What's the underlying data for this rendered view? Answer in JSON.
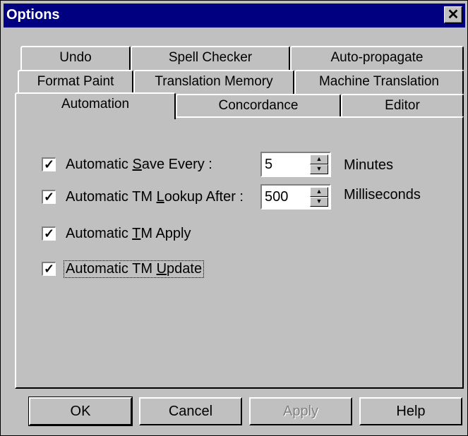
{
  "window": {
    "title": "Options",
    "close_glyph": "✕"
  },
  "tabs": {
    "row1": [
      "Undo",
      "Spell Checker",
      "Auto-propagate"
    ],
    "row2": [
      "Format Paint",
      "Translation Memory",
      "Machine Translation"
    ],
    "row3": [
      "Automation",
      "Concordance",
      "Editor"
    ],
    "selected": "Automation"
  },
  "options": {
    "auto_save": {
      "pre": "Automatic ",
      "key": "S",
      "post": "ave Every :",
      "checked": true,
      "value": "5",
      "unit": "Minutes"
    },
    "tm_lookup": {
      "pre": "Automatic TM ",
      "key": "L",
      "post": "ookup After :",
      "checked": true,
      "value": "500",
      "unit": "Milliseconds"
    },
    "tm_apply": {
      "pre": "Automatic ",
      "key": "T",
      "post": "M Apply",
      "checked": true
    },
    "tm_update": {
      "pre": "Automatic TM ",
      "key": "U",
      "post": "pdate",
      "checked": true
    }
  },
  "buttons": {
    "ok": "OK",
    "cancel": "Cancel",
    "apply": "Apply",
    "help": "Help"
  },
  "colors": {
    "titlebar": "#000080",
    "face": "#c0c0c0",
    "disabled_text": "#808080"
  },
  "icons": {
    "checkmark": "check-icon",
    "spin_up": "spin-up-icon",
    "spin_down": "spin-down-icon"
  }
}
